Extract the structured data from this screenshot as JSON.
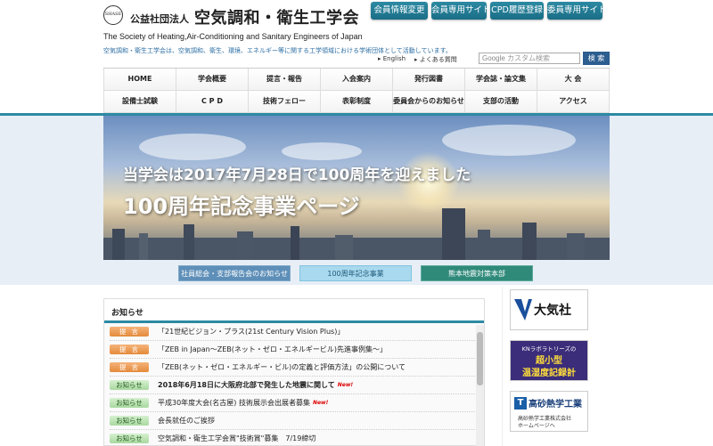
{
  "header": {
    "logo_mark": "SHASE",
    "org_type": "公益社団法人",
    "org_name": "空気調和・衛生工学会",
    "org_name_en": "The Society of Heating,Air-Conditioning and Sanitary Engineers of Japan",
    "tagline": "空気調和・衛生工学会は、空気調和、衛生、環境、エネルギー等に関する工学領域における学術団体として活動しています。",
    "link_english": "English",
    "link_faq": "よくある質問",
    "search_placeholder": "カスタム検索",
    "search_google": "Google",
    "search_button": "検 索"
  },
  "top_buttons": [
    {
      "label": "会員情報変更",
      "width": 64
    },
    {
      "label": "会員専用サイト",
      "width": 62
    },
    {
      "label": "CPD履歴登録",
      "width": 60
    },
    {
      "label": "委員専用サイト",
      "width": 62
    }
  ],
  "nav": {
    "row1": [
      "HOME",
      "学会概要",
      "提言・報告",
      "入会案内",
      "発行図書",
      "学会誌・論文集",
      "大 会"
    ],
    "row2": [
      "設備士試験",
      "C P D",
      "技術フェロー",
      "表彰制度",
      "委員会からのお知らせ",
      "支部の活動",
      "アクセス"
    ]
  },
  "hero": {
    "line1": "当学会は2017年7月28日で100周年を迎えました",
    "line2": "100周年記念事業ページ"
  },
  "banner_buttons": [
    {
      "label": "社員総会・支部報告会のお知らせ",
      "bg": "#5e8fb8",
      "fg": "#ffffff",
      "border": "#7fa7c8",
      "width": 126
    },
    {
      "label": "100周年記念事業",
      "bg": "#a9d9ee",
      "fg": "#1f5a7a",
      "border": "#7fc4e0",
      "width": 126
    },
    {
      "label": "熊本地震対策本部",
      "bg": "#2f8a7a",
      "fg": "#ffffff",
      "border": "#5caa9c",
      "width": 126
    }
  ],
  "notices": {
    "title": "お知らせ",
    "items": [
      {
        "badge": "提言",
        "type": "teian",
        "text": "「21世紀ビジョン・プラス(21st Century Vision Plus)」",
        "bold": false,
        "new": false
      },
      {
        "badge": "提言",
        "type": "teian",
        "text": "「ZEB in Japan～ZEB(ネット・ゼロ・エネルギービル)先進事例集～」",
        "bold": false,
        "new": false
      },
      {
        "badge": "提言",
        "type": "teian",
        "text": "「ZEB(ネット・ゼロ・エネルギー・ビル)の定義と評価方法」の公開について",
        "bold": false,
        "new": false
      },
      {
        "badge": "お知らせ",
        "type": "oshirase",
        "text": "2018年6月18日に大阪府北部で発生した地震に関して",
        "bold": true,
        "new": true
      },
      {
        "badge": "お知らせ",
        "type": "oshirase",
        "text": "平成30年度大会(名古屋) 技術展示会出展者募集",
        "bold": false,
        "new": true
      },
      {
        "badge": "お知らせ",
        "type": "oshirase",
        "text": "会長就任のご挨拶",
        "bold": false,
        "new": false
      },
      {
        "badge": "お知らせ",
        "type": "oshirase",
        "text": "空気調和・衛生工学会賞\"技術賞\"募集　7/19締切",
        "bold": false,
        "new": false
      }
    ],
    "new_label": "New!"
  },
  "ads": {
    "ad1": {
      "text": "大気社"
    },
    "ad2": {
      "line1": "KNラボラトリーズの",
      "line2": "超小型",
      "line3": "温湿度記録計"
    },
    "ad3": {
      "logo": "T",
      "name": "高砂熱学工業",
      "line1": "高砂熱学工業株式会社",
      "line2": "ホームページへ"
    }
  },
  "colors": {
    "accent": "#2c8aa3",
    "nav_line": "#2c8aa3"
  }
}
